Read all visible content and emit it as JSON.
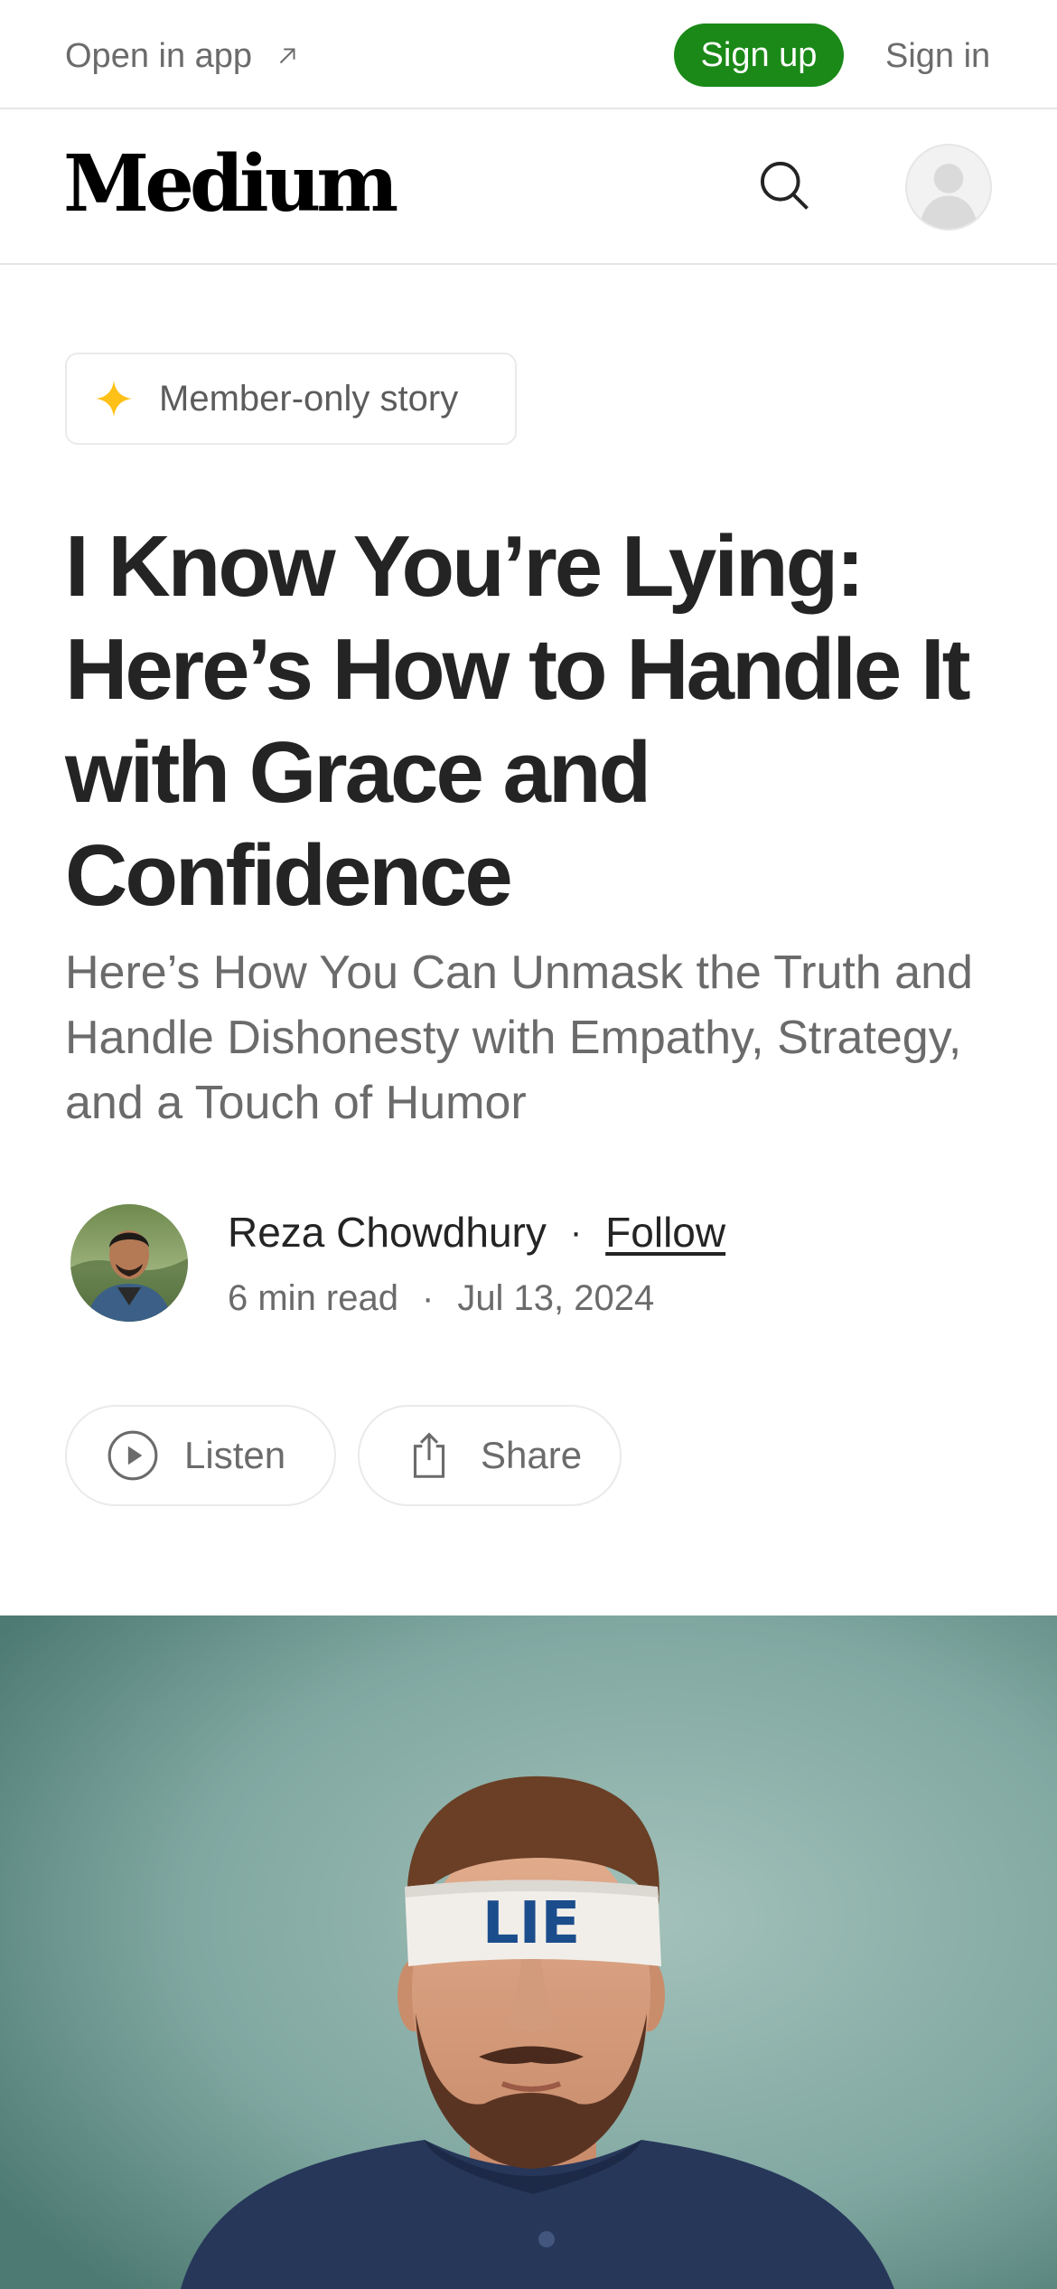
{
  "topbar": {
    "open_in_app": "Open in app",
    "sign_up": "Sign up",
    "sign_in": "Sign in"
  },
  "header": {
    "logo": "Medium"
  },
  "article": {
    "badge": "Member-only story",
    "title": "I Know You’re Lying: Here’s How to Handle It with Grace and Confidence",
    "subtitle": "Here’s How You Can Unmask the Truth and Handle Dishonesty with Empathy, Strategy, and a Touch of Humor",
    "author": {
      "name": "Reza Chowdhury",
      "follow": "Follow",
      "separator": "·"
    },
    "meta": {
      "read_time": "6 min read",
      "separator": "·",
      "date": "Jul 13, 2024"
    },
    "actions": {
      "listen": "Listen",
      "share": "Share"
    },
    "hero_image": {
      "blindfold_text": "LIE"
    }
  },
  "colors": {
    "brand_green": "#1a8917",
    "text_primary": "#242424",
    "text_secondary": "#6b6b6b",
    "badge_star": "#ffc017",
    "hero_background": "#7fa7a0"
  },
  "icons": [
    "arrow-up-right-icon",
    "search-icon",
    "user-avatar-icon",
    "star-icon",
    "play-circle-icon",
    "share-icon"
  ]
}
